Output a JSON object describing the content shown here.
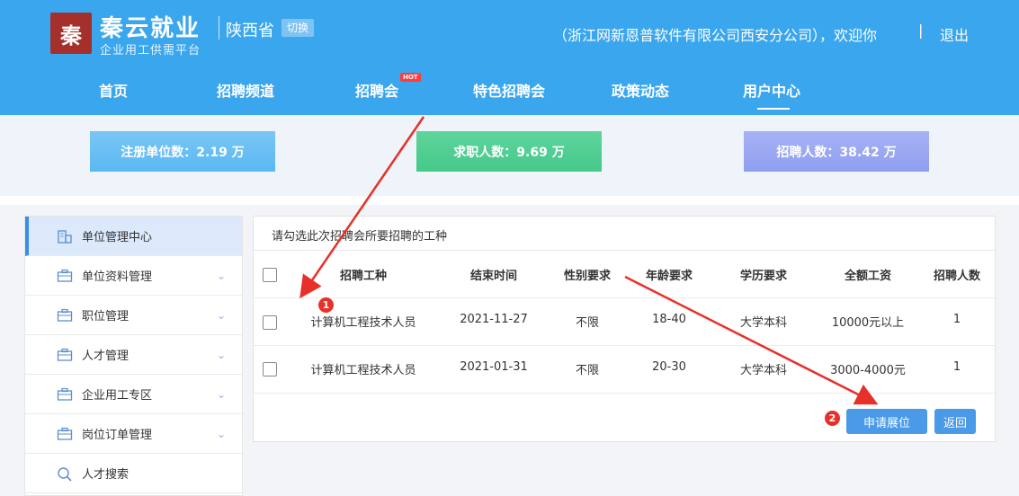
{
  "header": {
    "logo_glyph": "秦",
    "brand_title": "秦云就业",
    "brand_subtitle": "企业用工供需平台",
    "province": "陕西省",
    "switch_label": "切换",
    "welcome": "（浙江网新恩普软件有限公司西安分公司），欢迎你",
    "separator": "|",
    "logout": "退出"
  },
  "nav": {
    "items": [
      "首页",
      "招聘频道",
      "招聘会",
      "特色招聘会",
      "政策动态",
      "用户中心"
    ],
    "hot_badge": "HOT",
    "active": "用户中心"
  },
  "stats": {
    "registered_units": "注册单位数：2.19 万",
    "job_seekers": "求职人数：9.69 万",
    "recruits": "招聘人数：38.42 万"
  },
  "sidebar": {
    "items": [
      {
        "label": "单位管理中心",
        "icon": "building-icon",
        "active": true
      },
      {
        "label": "单位资料管理",
        "icon": "briefcase-icon"
      },
      {
        "label": "职位管理",
        "icon": "briefcase-icon"
      },
      {
        "label": "人才管理",
        "icon": "briefcase-icon"
      },
      {
        "label": "企业用工专区",
        "icon": "briefcase-icon"
      },
      {
        "label": "岗位订单管理",
        "icon": "briefcase-icon"
      },
      {
        "label": "人才搜索",
        "icon": "search-icon"
      }
    ]
  },
  "panel": {
    "title": "请勾选此次招聘会所要招聘的工种",
    "columns": [
      "招聘工种",
      "结束时间",
      "性别要求",
      "年龄要求",
      "学历要求",
      "全额工资",
      "招聘人数"
    ],
    "rows": [
      [
        "计算机工程技术人员",
        "2021-11-27",
        "不限",
        "18-40",
        "大学本科",
        "10000元以上",
        "1"
      ],
      [
        "计算机工程技术人员",
        "2021-01-31",
        "不限",
        "20-30",
        "大学本科",
        "3000-4000元",
        "1"
      ]
    ],
    "apply_button": "申请展位",
    "back_button": "返回"
  },
  "annotations": {
    "marker_1": "1",
    "marker_2": "2",
    "arrow_color": "#e8302a"
  }
}
